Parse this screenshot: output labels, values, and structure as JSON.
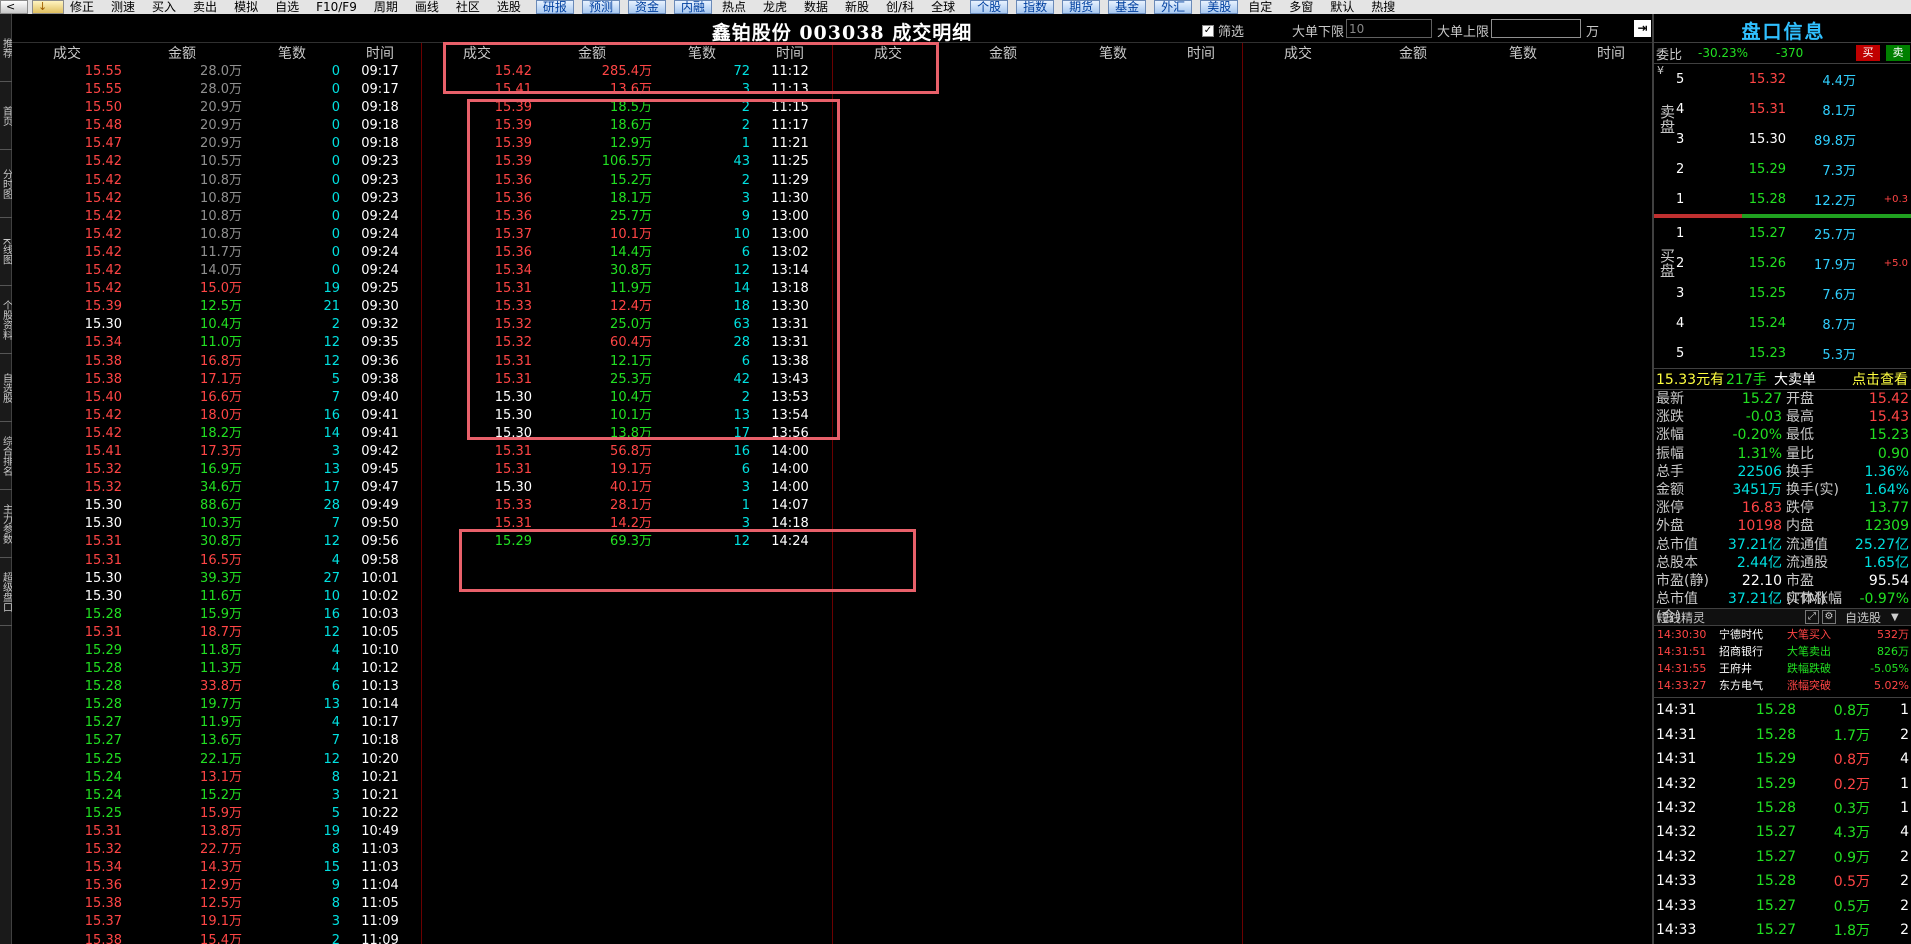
{
  "toolbar": {
    "btn_back": "<",
    "btn_down": "↓",
    "menu": [
      {
        "label": "修正",
        "tab": false
      },
      {
        "label": "测速",
        "tab": false
      },
      {
        "label": "买入",
        "tab": false
      },
      {
        "label": "卖出",
        "tab": false
      },
      {
        "label": "模拟",
        "tab": false
      },
      {
        "label": "自选",
        "tab": false
      },
      {
        "label": "F10/F9",
        "tab": false
      },
      {
        "label": "周期",
        "tab": false
      },
      {
        "label": "画线",
        "tab": false
      },
      {
        "label": "社区",
        "tab": false
      },
      {
        "label": "选股",
        "tab": false
      },
      {
        "label": "研报",
        "tab": true
      },
      {
        "label": "预测",
        "tab": true
      },
      {
        "label": "资金",
        "tab": true
      },
      {
        "label": "内融",
        "tab": true
      },
      {
        "label": "热点",
        "tab": false
      },
      {
        "label": "龙虎",
        "tab": false
      },
      {
        "label": "数据",
        "tab": false
      },
      {
        "label": "新股",
        "tab": false
      },
      {
        "label": "创/科",
        "tab": false
      },
      {
        "label": "全球",
        "tab": false
      },
      {
        "label": "个股",
        "tab": true
      },
      {
        "label": "指数",
        "tab": true
      },
      {
        "label": "期货",
        "tab": true
      },
      {
        "label": "基金",
        "tab": true
      },
      {
        "label": "外汇",
        "tab": true
      },
      {
        "label": "美股",
        "tab": true
      },
      {
        "label": "自定",
        "tab": false
      },
      {
        "label": "多窗",
        "tab": false
      },
      {
        "label": "默认",
        "tab": false
      },
      {
        "label": "热搜",
        "tab": false
      }
    ]
  },
  "left_strip": [
    "推荐",
    "首页",
    "分时图",
    "K线图",
    "个股资料",
    "自选股",
    "综合排名",
    "主力参数",
    "超级盘口"
  ],
  "header": {
    "title": "鑫铂股份 003038 成交明细",
    "filter_label": "筛选",
    "filter_checked": "✓",
    "low_limit_label": "大单下限",
    "low_limit_value": "10",
    "high_limit_label": "大单上限",
    "high_limit_value": "",
    "unit": "万",
    "exit_icon": "⇥"
  },
  "columns": [
    "成交",
    "金额",
    "笔数",
    "时间"
  ],
  "col1": [
    [
      "15.55",
      "28.0万",
      "0",
      "09:17",
      "r",
      "g"
    ],
    [
      "15.55",
      "28.0万",
      "0",
      "09:17",
      "r",
      "g"
    ],
    [
      "15.50",
      "20.9万",
      "0",
      "09:18",
      "r",
      "g"
    ],
    [
      "15.48",
      "20.9万",
      "0",
      "09:18",
      "r",
      "g"
    ],
    [
      "15.47",
      "20.9万",
      "0",
      "09:18",
      "r",
      "g"
    ],
    [
      "15.42",
      "10.5万",
      "0",
      "09:23",
      "r",
      "g"
    ],
    [
      "15.42",
      "10.8万",
      "0",
      "09:23",
      "r",
      "g"
    ],
    [
      "15.42",
      "10.8万",
      "0",
      "09:23",
      "r",
      "g"
    ],
    [
      "15.42",
      "10.8万",
      "0",
      "09:24",
      "r",
      "g"
    ],
    [
      "15.42",
      "10.8万",
      "0",
      "09:24",
      "r",
      "g"
    ],
    [
      "15.42",
      "11.7万",
      "0",
      "09:24",
      "r",
      "g"
    ],
    [
      "15.42",
      "14.0万",
      "0",
      "09:24",
      "r",
      "g"
    ],
    [
      "15.42",
      "15.0万",
      "19",
      "09:25",
      "r",
      "r"
    ],
    [
      "15.39",
      "12.5万",
      "21",
      "09:30",
      "r",
      "G"
    ],
    [
      "15.30",
      "10.4万",
      "2",
      "09:32",
      "w",
      "G"
    ],
    [
      "15.34",
      "11.0万",
      "12",
      "09:35",
      "r",
      "G"
    ],
    [
      "15.38",
      "16.8万",
      "12",
      "09:36",
      "r",
      "r"
    ],
    [
      "15.38",
      "17.1万",
      "5",
      "09:38",
      "r",
      "r"
    ],
    [
      "15.40",
      "16.6万",
      "7",
      "09:40",
      "r",
      "r"
    ],
    [
      "15.42",
      "18.0万",
      "16",
      "09:41",
      "r",
      "r"
    ],
    [
      "15.42",
      "18.2万",
      "14",
      "09:41",
      "r",
      "G"
    ],
    [
      "15.41",
      "17.3万",
      "3",
      "09:42",
      "r",
      "r"
    ],
    [
      "15.32",
      "16.9万",
      "13",
      "09:45",
      "r",
      "G"
    ],
    [
      "15.32",
      "34.6万",
      "17",
      "09:47",
      "r",
      "G"
    ],
    [
      "15.30",
      "88.6万",
      "28",
      "09:49",
      "w",
      "G"
    ],
    [
      "15.30",
      "10.3万",
      "7",
      "09:50",
      "w",
      "G"
    ],
    [
      "15.31",
      "30.8万",
      "12",
      "09:56",
      "r",
      "G"
    ],
    [
      "15.31",
      "16.5万",
      "4",
      "09:58",
      "r",
      "r"
    ],
    [
      "15.30",
      "39.3万",
      "27",
      "10:01",
      "w",
      "G"
    ],
    [
      "15.30",
      "11.6万",
      "10",
      "10:02",
      "w",
      "G"
    ],
    [
      "15.28",
      "15.9万",
      "16",
      "10:03",
      "G",
      "G"
    ],
    [
      "15.31",
      "18.7万",
      "12",
      "10:05",
      "r",
      "r"
    ],
    [
      "15.29",
      "11.8万",
      "4",
      "10:10",
      "G",
      "G"
    ],
    [
      "15.28",
      "11.3万",
      "4",
      "10:12",
      "G",
      "G"
    ],
    [
      "15.28",
      "33.8万",
      "6",
      "10:13",
      "G",
      "r"
    ],
    [
      "15.28",
      "19.7万",
      "13",
      "10:14",
      "G",
      "G"
    ],
    [
      "15.27",
      "11.9万",
      "4",
      "10:17",
      "G",
      "G"
    ],
    [
      "15.27",
      "13.6万",
      "7",
      "10:18",
      "G",
      "G"
    ],
    [
      "15.25",
      "22.1万",
      "12",
      "10:20",
      "G",
      "G"
    ],
    [
      "15.24",
      "13.1万",
      "8",
      "10:21",
      "G",
      "r"
    ],
    [
      "15.24",
      "15.2万",
      "3",
      "10:21",
      "G",
      "G"
    ],
    [
      "15.25",
      "15.9万",
      "5",
      "10:22",
      "G",
      "r"
    ],
    [
      "15.31",
      "13.8万",
      "19",
      "10:49",
      "r",
      "r"
    ],
    [
      "15.32",
      "22.7万",
      "8",
      "11:03",
      "r",
      "r"
    ],
    [
      "15.34",
      "14.3万",
      "15",
      "11:03",
      "r",
      "r"
    ],
    [
      "15.36",
      "12.9万",
      "9",
      "11:04",
      "r",
      "r"
    ],
    [
      "15.38",
      "12.5万",
      "8",
      "11:05",
      "r",
      "r"
    ],
    [
      "15.37",
      "19.1万",
      "3",
      "11:09",
      "r",
      "r"
    ],
    [
      "15.38",
      "15.4万",
      "2",
      "11:09",
      "r",
      "r"
    ]
  ],
  "col2": [
    [
      "15.42",
      "285.4万",
      "72",
      "11:12",
      "r",
      "r"
    ],
    [
      "15.41",
      "13.6万",
      "3",
      "11:13",
      "r",
      "r"
    ],
    [
      "15.39",
      "18.5万",
      "2",
      "11:15",
      "r",
      "G"
    ],
    [
      "15.39",
      "18.6万",
      "2",
      "11:17",
      "r",
      "G"
    ],
    [
      "15.39",
      "12.9万",
      "1",
      "11:21",
      "r",
      "G"
    ],
    [
      "15.39",
      "106.5万",
      "43",
      "11:25",
      "r",
      "G"
    ],
    [
      "15.36",
      "15.2万",
      "2",
      "11:29",
      "r",
      "G"
    ],
    [
      "15.36",
      "18.1万",
      "3",
      "11:30",
      "r",
      "G"
    ],
    [
      "15.36",
      "25.7万",
      "9",
      "13:00",
      "r",
      "G"
    ],
    [
      "15.37",
      "10.1万",
      "10",
      "13:00",
      "r",
      "r"
    ],
    [
      "15.36",
      "14.4万",
      "6",
      "13:02",
      "r",
      "G"
    ],
    [
      "15.34",
      "30.8万",
      "12",
      "13:14",
      "r",
      "G"
    ],
    [
      "15.31",
      "11.9万",
      "14",
      "13:18",
      "r",
      "G"
    ],
    [
      "15.33",
      "12.4万",
      "18",
      "13:30",
      "r",
      "r"
    ],
    [
      "15.32",
      "25.0万",
      "63",
      "13:31",
      "r",
      "G"
    ],
    [
      "15.32",
      "60.4万",
      "28",
      "13:31",
      "r",
      "r"
    ],
    [
      "15.31",
      "12.1万",
      "6",
      "13:38",
      "r",
      "G"
    ],
    [
      "15.31",
      "25.3万",
      "42",
      "13:43",
      "r",
      "G"
    ],
    [
      "15.30",
      "10.4万",
      "2",
      "13:53",
      "w",
      "G"
    ],
    [
      "15.30",
      "10.1万",
      "13",
      "13:54",
      "w",
      "G"
    ],
    [
      "15.30",
      "13.8万",
      "17",
      "13:56",
      "w",
      "G"
    ],
    [
      "15.31",
      "56.8万",
      "16",
      "14:00",
      "r",
      "r"
    ],
    [
      "15.31",
      "19.1万",
      "6",
      "14:00",
      "r",
      "r"
    ],
    [
      "15.30",
      "40.1万",
      "3",
      "14:00",
      "w",
      "r"
    ],
    [
      "15.33",
      "28.1万",
      "1",
      "14:07",
      "r",
      "r"
    ],
    [
      "15.31",
      "14.2万",
      "3",
      "14:18",
      "r",
      "r"
    ],
    [
      "15.29",
      "69.3万",
      "12",
      "14:24",
      "G",
      "G"
    ]
  ],
  "highlights": [
    "box-top",
    "box-middle",
    "box-bottom"
  ],
  "right_panel": {
    "title": "盘口信息",
    "weibi_label": "委比",
    "weibi_pct": "-30.23%",
    "weibi_diff": "-370",
    "buy_btn": "买",
    "sell_btn": "卖",
    "sell_side_label": "卖盘",
    "buy_side_label": "买盘",
    "yen_icon": "¥",
    "asks": [
      [
        "5",
        "15.32",
        "4.4万",
        "",
        "r",
        ""
      ],
      [
        "4",
        "15.31",
        "8.1万",
        "",
        "r",
        ""
      ],
      [
        "3",
        "15.30",
        "89.8万",
        "",
        "w",
        ""
      ],
      [
        "2",
        "15.29",
        "7.3万",
        "",
        "G",
        ""
      ],
      [
        "1",
        "15.28",
        "12.2万",
        "+0.3",
        "G",
        "r"
      ]
    ],
    "bids": [
      [
        "1",
        "15.27",
        "25.7万",
        "",
        "G",
        ""
      ],
      [
        "2",
        "15.26",
        "17.9万",
        "+5.0",
        "G",
        "r"
      ],
      [
        "3",
        "15.25",
        "7.6万",
        "",
        "G",
        ""
      ],
      [
        "4",
        "15.24",
        "8.7万",
        "",
        "G",
        ""
      ],
      [
        "5",
        "15.23",
        "5.3万",
        "",
        "G",
        ""
      ]
    ],
    "bigsell": {
      "price": "15.33元有",
      "qty": "217手",
      "kind": "大卖单",
      "click": "点击查看"
    },
    "stats": [
      [
        "最新",
        "15.27",
        "G",
        "开盘",
        "15.42",
        "r"
      ],
      [
        "涨跌",
        "-0.03",
        "G",
        "最高",
        "15.43",
        "r"
      ],
      [
        "涨幅",
        "-0.20%",
        "G",
        "最低",
        "15.23",
        "G"
      ],
      [
        "振幅",
        "1.31%",
        "G",
        "量比",
        "0.90",
        "G"
      ],
      [
        "总手",
        "22506",
        "c",
        "换手",
        "1.36%",
        "c"
      ],
      [
        "金额",
        "3451万",
        "c",
        "换手(实)",
        "1.64%",
        "c"
      ],
      [
        "涨停",
        "16.83",
        "r",
        "跌停",
        "13.77",
        "G"
      ],
      [
        "外盘",
        "10198",
        "r",
        "内盘",
        "12309",
        "G"
      ],
      [
        "总市值",
        "37.21亿",
        "c",
        "流通值",
        "25.27亿",
        "c"
      ],
      [
        "总股本",
        "2.44亿",
        "c",
        "流通股",
        "1.65亿",
        "c"
      ],
      [
        "市盈(静)",
        "22.10",
        "w",
        "市盈(TTM)",
        "95.54",
        "w"
      ],
      [
        "总市值(合)",
        "37.21亿",
        "c",
        "实体涨幅",
        "-0.97%",
        "G"
      ]
    ],
    "sprite": {
      "title": "短线精灵",
      "icon1": "⤢",
      "icon2": "⚙",
      "select": "自选股",
      "dropdown_icon": "▼",
      "rows": [
        [
          "14:30:30",
          "宁德时代",
          "大笔买入",
          "532万",
          "r"
        ],
        [
          "14:31:51",
          "招商银行",
          "大笔卖出",
          "826万",
          "G"
        ],
        [
          "14:31:55",
          "王府井",
          "跌幅跌破",
          "-5.05%",
          "G"
        ],
        [
          "14:33:27",
          "东方电气",
          "涨幅突破",
          "5.02%",
          "r"
        ]
      ]
    },
    "ticks": [
      [
        "14:31",
        "15.28",
        "G",
        "0.8万",
        "G",
        "1"
      ],
      [
        "14:31",
        "15.28",
        "G",
        "1.7万",
        "G",
        "2"
      ],
      [
        "14:31",
        "15.29",
        "G",
        "0.8万",
        "r",
        "4"
      ],
      [
        "14:32",
        "15.29",
        "G",
        "0.2万",
        "r",
        "1"
      ],
      [
        "14:32",
        "15.28",
        "G",
        "0.3万",
        "G",
        "1"
      ],
      [
        "14:32",
        "15.27",
        "G",
        "4.3万",
        "G",
        "4"
      ],
      [
        "14:32",
        "15.27",
        "G",
        "0.9万",
        "G",
        "2"
      ],
      [
        "14:33",
        "15.28",
        "G",
        "0.5万",
        "r",
        "2"
      ],
      [
        "14:33",
        "15.27",
        "G",
        "0.5万",
        "G",
        "2"
      ],
      [
        "14:33",
        "15.27",
        "G",
        "1.8万",
        "G",
        "2"
      ]
    ]
  }
}
